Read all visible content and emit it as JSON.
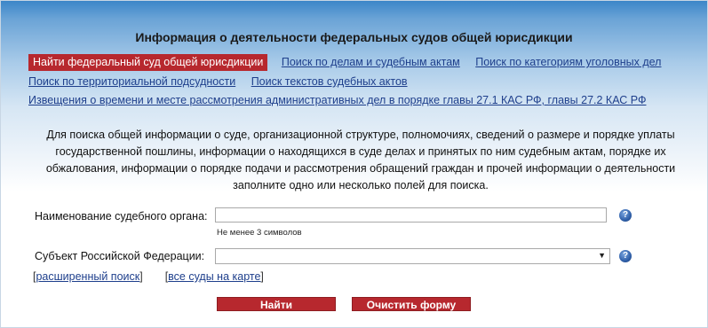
{
  "header": {
    "title": "Информация о деятельности федеральных судов общей юрисдикции"
  },
  "nav": {
    "active": "Найти федеральный суд общей юрисдикции",
    "row1": [
      "Поиск по делам и судебным актам",
      "Поиск по категориям уголовных дел"
    ],
    "row2": [
      "Поиск по территориальной подсудности",
      "Поиск текстов судебных актов"
    ],
    "row3": [
      "Извещения о времени и месте рассмотрения административных дел в порядке главы 27.1 КАС РФ, главы 27.2 КАС РФ"
    ]
  },
  "description": {
    "lines": [
      "Для поиска общей информации о суде, организационной структуре, полномочиях, сведений о размере и порядке уплаты",
      "государственной пошлины, информации о находящихся в суде делах и принятых по ним судебным актам, порядке их",
      "обжалования, информации о порядке подачи и рассмотрения обращений граждан и прочей информации о деятельности",
      "заполните одно или несколько полей для поиска."
    ]
  },
  "form": {
    "court_label": "Наименование судебного органа:",
    "court_value": "",
    "court_hint": "Не менее 3 символов",
    "subject_label": "Субъект Российской Федерации:",
    "subject_value": "",
    "help_icon": "help-icon"
  },
  "links": {
    "advanced_search": "расширенный поиск",
    "all_courts_map": "все суды на карте"
  },
  "buttons": {
    "find": "Найти",
    "clear": "Очистить форму"
  },
  "colors": {
    "accent": "#b7282e",
    "link": "#1e3f8c",
    "header_gradient_top": "#3c86c8"
  }
}
